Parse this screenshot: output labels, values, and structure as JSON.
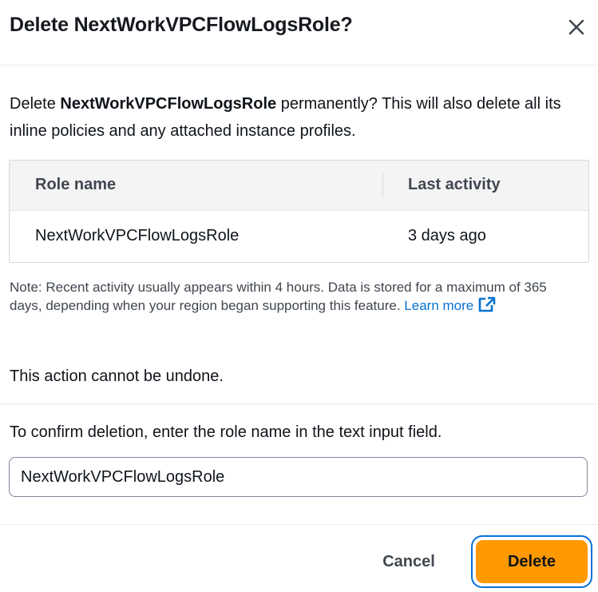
{
  "dialog": {
    "title": "Delete NextWorkVPCFlowLogsRole?",
    "close_icon": "close-icon"
  },
  "intro": {
    "prefix": "Delete ",
    "role_name": "NextWorkVPCFlowLogsRole",
    "suffix": " permanently? This will also delete all its inline policies and any attached instance profiles."
  },
  "table": {
    "columns": [
      "Role name",
      "Last activity"
    ],
    "rows": [
      [
        "NextWorkVPCFlowLogsRole",
        "3 days ago"
      ]
    ]
  },
  "note": {
    "text": "Note: Recent activity usually appears within 4 hours. Data is stored for a maximum of 365 days, depending when your region began supporting this feature. ",
    "link_label": "Learn more",
    "link_icon": "external-link-icon"
  },
  "warning": "This action cannot be undone.",
  "confirm": {
    "label": "To confirm deletion, enter the role name in the text input field.",
    "value": "NextWorkVPCFlowLogsRole"
  },
  "footer": {
    "cancel_label": "Cancel",
    "delete_label": "Delete"
  },
  "colors": {
    "primary_button": "#ff9900",
    "focus_ring": "#0972d3",
    "link": "#0972d3"
  }
}
